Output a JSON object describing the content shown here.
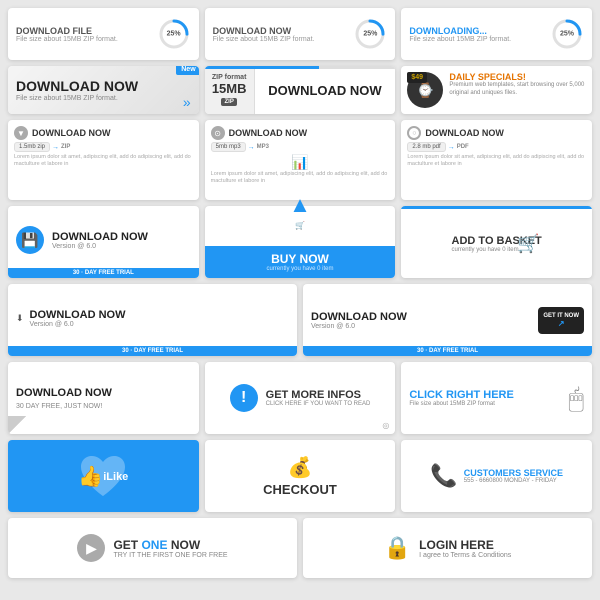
{
  "bg": "#e0e0e0",
  "row1": {
    "cards": [
      {
        "title": "Download file",
        "sub": "File size  about 15MB ZIP format.",
        "pct": "25%",
        "pct_val": 25
      },
      {
        "title": "DOWNLOAD NOW",
        "sub": "File size  about 15MB ZIP format.",
        "pct": "25%",
        "pct_val": 25
      },
      {
        "title": "Downloading...",
        "sub": "File size  about 15MB ZIP format.",
        "pct": "25%",
        "pct_val": 25
      }
    ]
  },
  "row2": {
    "cards": [
      {
        "type": "download-big",
        "main": "DOWNLOAD NOW",
        "sub": "File size about 15MB ZIP format.",
        "ribbon": "New"
      },
      {
        "type": "zip-download",
        "zip_label": "ZIP format",
        "zip_size": "15MB",
        "zip_type": "ZIP",
        "btn_label": "DOWNLOAD NOW"
      },
      {
        "type": "daily-specials",
        "title": "DAILY SPECIALS!",
        "sub": "Premium web templates, start browsing over 5,000 original and uniques files.",
        "price": "$49"
      }
    ]
  },
  "row3": {
    "cards": [
      {
        "icon_type": "down-triangle",
        "label": "DOWNLOAD NOW",
        "file_size": "1.5mb zip",
        "format": "ZIP",
        "body": "Lorem ipsum dolor sit amet, adipiscing elit, add do adipiscing elit, add do mactulture et labore in"
      },
      {
        "icon_type": "circle-icon",
        "label": "DOWNLOAD NOW",
        "file_size": "5mb mp3",
        "format": "MP3",
        "body": "Lorem ipsum dolor sit amet, adipiscing elit, add do adipiscing elit, add do mactulture et labore in"
      },
      {
        "icon_type": "circle-outline",
        "label": "DOWNLOAD NOW",
        "file_size": "2.8 mb pdf",
        "format": "PDF",
        "body": "Lorem ipsum dolor sit amet, adipiscing elit, add do adipiscing elit, add do mactulture et labore in"
      }
    ]
  },
  "row4": {
    "cards": [
      {
        "type": "dl-v2",
        "main": "DOWNLOAD NOW",
        "version": "Version @ 6.0",
        "trial": "30 · DAY FREE TRIAL"
      },
      {
        "type": "buy-now",
        "main": "BUY NOW",
        "sub": "currently you have 0 item"
      },
      {
        "type": "basket",
        "main": "ADD TO BASKET",
        "sub": "currently you have 0 item"
      },
      {
        "type": "getit",
        "main": "DOWNLOAD NOW",
        "version": "Version @ 6.0",
        "trial": "30 · DAY FREE TRIAL",
        "badge": "GET IT NOW"
      }
    ]
  },
  "row5": {
    "cards": [
      {
        "type": "curl-dl",
        "main": "DOWNLOAD NOW",
        "sub": "30 DAY FREE, JUST NOW!"
      },
      {
        "type": "more-infos",
        "main": "GET MORE INFOS",
        "sub": "CLICK HERE IF YOU WANT TO READ"
      },
      {
        "type": "click-here",
        "main": "CLICK RIGHT HERE",
        "sub": "File size about 15MB ZIP format"
      }
    ]
  },
  "row6": {
    "cards": [
      {
        "type": "ilike",
        "label": "iLike"
      },
      {
        "type": "checkout",
        "main": "CHECKOUT"
      },
      {
        "type": "customers",
        "main": "CUSTOMERS SERVICE",
        "sub": "555 - 6660800  MONDAY - FRIDAY"
      }
    ]
  },
  "row7": {
    "cards": [
      {
        "type": "get-one",
        "main_a": "GET ",
        "main_b": "ONE",
        "main_c": " NOW",
        "sub": "TRY IT THE FIRST ONE FOR FREE"
      },
      {
        "type": "login",
        "main": "LOGIN HERE",
        "sub": "I agree to Terms & Conditions"
      }
    ]
  }
}
